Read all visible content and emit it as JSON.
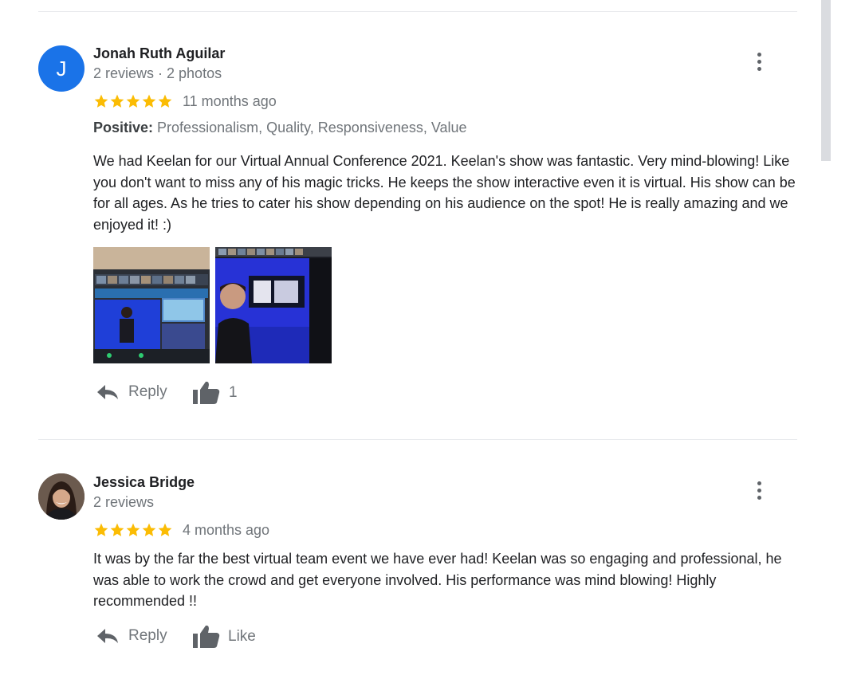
{
  "reviews": [
    {
      "author": "Jonah Ruth Aguilar",
      "avatar_letter": "J",
      "meta": "2 reviews · 2 photos",
      "rating": 5,
      "date": "11 months ago",
      "positive_label": "Positive:",
      "positive_values": "Professionalism, Quality, Responsiveness, Value",
      "text": "We had Keelan for our Virtual Annual Conference 2021. Keelan's show was fantastic. Very mind-blowing! Like you don't want to miss any of his magic tricks. He keeps the show interactive even it is virtual. His show can be for all ages. As he tries to cater his show depending on his audience on the spot! He is really amazing and we enjoyed it! :)",
      "reply_label": "Reply",
      "like_label": "1"
    },
    {
      "author": "Jessica Bridge",
      "meta": "2 reviews",
      "rating": 5,
      "date": "4 months ago",
      "text": "It was by the far the best virtual team event we have ever had! Keelan was so engaging and professional, he was able to work the crowd and get everyone involved. His performance was mind blowing! Highly recommended !!",
      "reply_label": "Reply",
      "like_label": "Like"
    }
  ],
  "icons": {
    "avatar_color": "#1a73e8",
    "star_color": "#fbbc04",
    "action_icon_color": "#5f6368",
    "more": "more-vertical-icon",
    "reply": "reply-icon",
    "like": "thumbs-up-icon",
    "star": "star-icon"
  }
}
